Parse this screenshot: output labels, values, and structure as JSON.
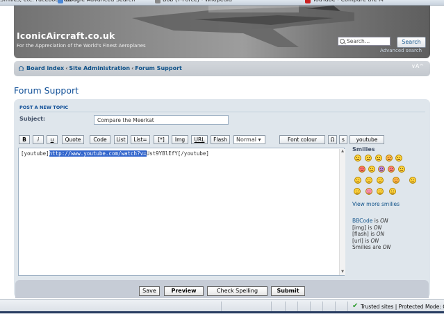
{
  "browser_tabs": [
    {
      "label": "Smilies, etc. Facebook Gam",
      "icon": "page-icon",
      "color": "#3a6ea5"
    },
    {
      "label": "Google Advanced Search",
      "icon": "google-icon",
      "color": "#4a87d6"
    },
    {
      "label": "Bob (T-Force) - Wikipedia",
      "icon": "wikipedia-icon",
      "color": "#888888"
    },
    {
      "label": "YouTube - Compare the M",
      "icon": "youtube-icon",
      "color": "#cc2222"
    }
  ],
  "header": {
    "site_name": "IconicAircraft.co.uk",
    "tagline": "For the Appreciation of the World's Finest Aeroplanes",
    "search_placeholder": "Search…",
    "search_button": "Search",
    "advanced_search": "Advanced search"
  },
  "breadcrumb": {
    "items": [
      "Board index",
      "Site Administration",
      "Forum Support"
    ],
    "separator": "‹",
    "collapse_label": "∨A^"
  },
  "page_title": "Forum Support",
  "form": {
    "legend": "POST A NEW TOPIC",
    "subject_label": "Subject:",
    "subject_value": "Compare the Meerkat",
    "toolbar": [
      "B",
      "i",
      "u",
      "Quote",
      "Code",
      "List",
      "List=",
      "[*]",
      "Img",
      "URL",
      "Flash"
    ],
    "font_size_selected": "Normal",
    "font_colour": "Font colour",
    "toolbar_extra": [
      "Ω",
      "s",
      "youtube"
    ],
    "message": {
      "before": "[youtube]",
      "selected": "http://www.youtube.com/watch?v=",
      "after": "Ust9YBlEfY[/youtube]"
    }
  },
  "smilies": {
    "title": "Smilies",
    "count": 19,
    "view_more": "View more smilies"
  },
  "bbcode_info": [
    {
      "label": "BBCode",
      "state": "ON",
      "link": true,
      "verb": "is"
    },
    {
      "label": "[img]",
      "state": "ON",
      "link": false,
      "verb": "is"
    },
    {
      "label": "[flash]",
      "state": "ON",
      "link": false,
      "verb": "is"
    },
    {
      "label": "[url]",
      "state": "ON",
      "link": false,
      "verb": "is"
    },
    {
      "label": "Smilies",
      "state": "ON",
      "link": false,
      "verb": "are"
    }
  ],
  "submit_buttons": [
    "Save",
    "Preview",
    "Check Spelling",
    "Submit"
  ],
  "statusbar": {
    "zone": "Trusted sites | Protected Mode: Of"
  }
}
